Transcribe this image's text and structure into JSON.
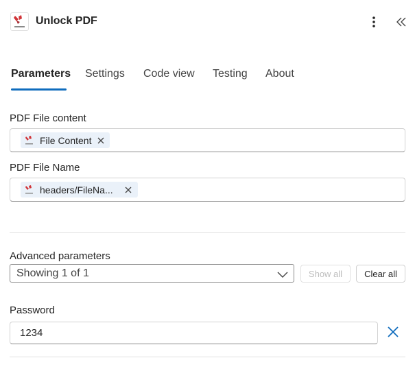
{
  "header": {
    "title": "Unlock PDF",
    "app_icon": "pdf-unlock-logo",
    "more_icon": "more-vertical-icon",
    "collapse_icon": "double-chevron-left-icon"
  },
  "tabs": [
    {
      "label": "Parameters",
      "active": true
    },
    {
      "label": "Settings",
      "active": false
    },
    {
      "label": "Code view",
      "active": false
    },
    {
      "label": "Testing",
      "active": false
    },
    {
      "label": "About",
      "active": false
    }
  ],
  "fields": {
    "pdf_content": {
      "label": "PDF File content",
      "token": "File Content"
    },
    "pdf_name": {
      "label": "PDF File Name",
      "token": "headers/FileNa..."
    }
  },
  "advanced": {
    "label": "Advanced parameters",
    "selected": "Showing 1 of 1",
    "show_all": "Show all",
    "clear_all": "Clear all"
  },
  "password": {
    "label": "Password",
    "value": "1234"
  },
  "colors": {
    "accent": "#0f6cbd",
    "token_bg": "#eaf1f9",
    "logo_red": "#d13438"
  }
}
